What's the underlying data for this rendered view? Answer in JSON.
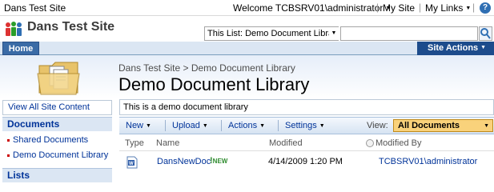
{
  "topbar": {
    "site_breadcrumb": "Dans Test Site",
    "welcome": "Welcome TCBSRV01\\administrator",
    "my_site": "My Site",
    "my_links": "My Links",
    "separator": "|"
  },
  "header": {
    "site_title": "Dans Test Site",
    "search_scope": "This List: Demo Document Libra",
    "search_value": ""
  },
  "navbar": {
    "home_tab": "Home",
    "site_actions": "Site Actions"
  },
  "title_area": {
    "breadcrumb": "Dans Test Site > Demo Document Library",
    "title": "Demo Document Library"
  },
  "leftnav": {
    "view_all": "View All Site Content",
    "documents_heading": "Documents",
    "items": [
      {
        "label": "Shared Documents"
      },
      {
        "label": "Demo Document Library"
      }
    ],
    "lists_heading": "Lists"
  },
  "main": {
    "description": "This is a demo document library",
    "toolbar": {
      "new": "New",
      "upload": "Upload",
      "actions": "Actions",
      "settings": "Settings",
      "view_label": "View:",
      "view_value": "All Documents"
    },
    "columns": {
      "type": "Type",
      "name": "Name",
      "modified": "Modified",
      "modified_by": "Modified By"
    },
    "rows": [
      {
        "name": "DansNewDoc",
        "badge": "NEW",
        "modified": "4/14/2009 1:20 PM",
        "modified_by": "TCBSRV01\\administrator"
      }
    ]
  },
  "colors": {
    "link": "#003399",
    "nav_blue": "#1d4c8c",
    "view_highlight": "#f9d27b",
    "new_badge": "#2e8b2e"
  },
  "icons": [
    "logo-icon",
    "help-icon",
    "search-icon",
    "folder-icon",
    "word-document-icon",
    "radio-icon"
  ]
}
